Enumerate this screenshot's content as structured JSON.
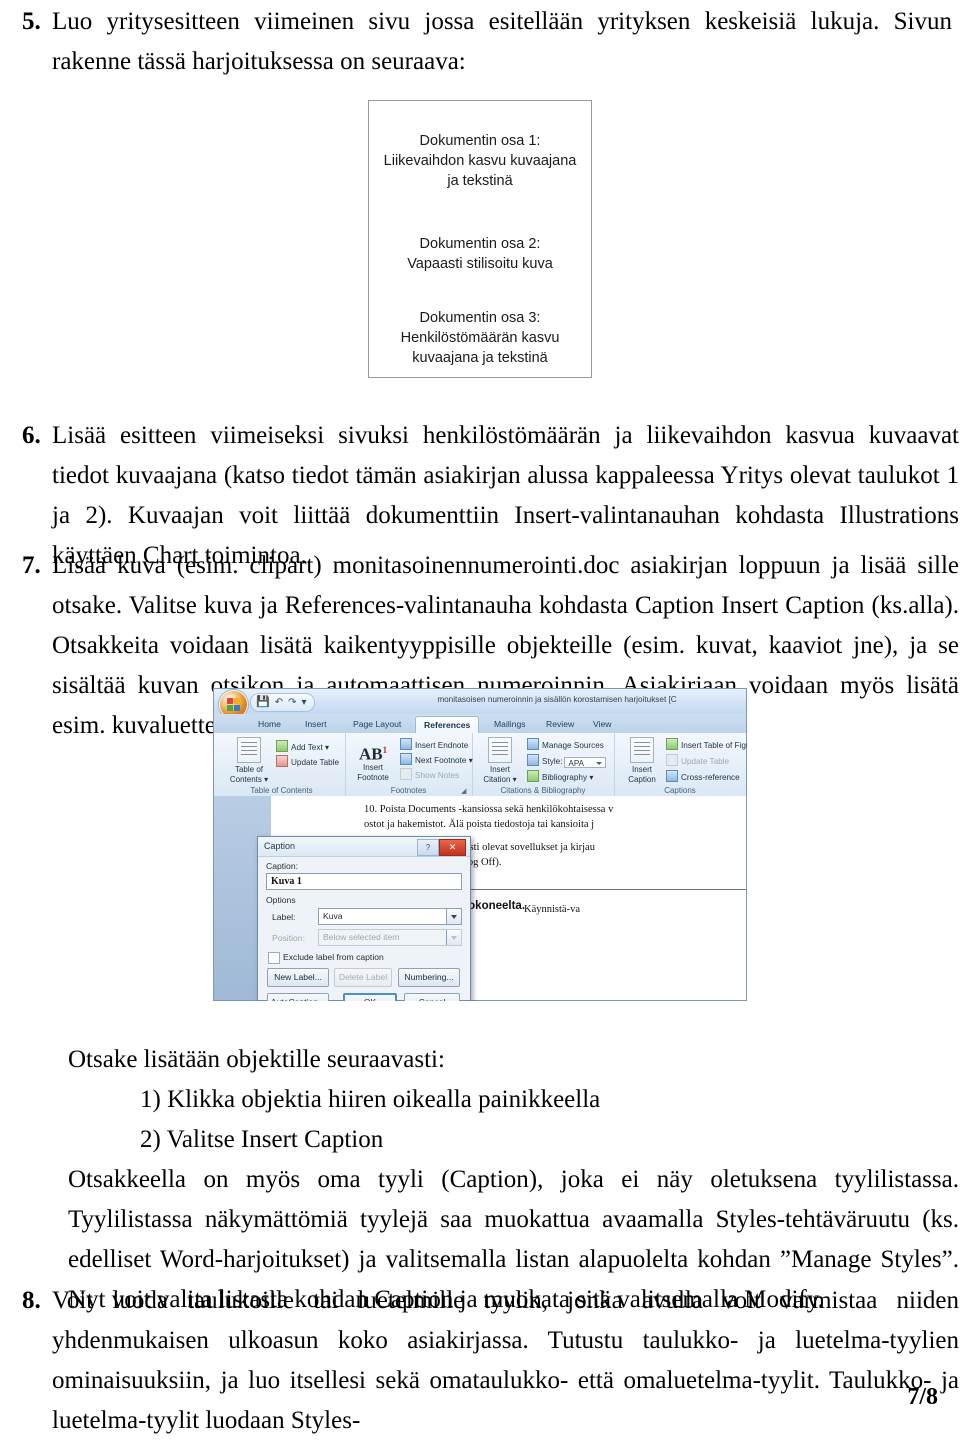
{
  "document": {
    "items": [
      {
        "number": "5.",
        "text": "Luo yritysesitteen viimeinen sivu jossa esitellään yrityksen keskeisiä lukuja. Sivun rakenne tässä harjoituksessa on seuraava:"
      },
      {
        "number": "6.",
        "text": "Lisää esitteen viimeiseksi sivuksi henkilöstömäärän ja liikevaihdon kasvua kuvaavat tiedot kuvaajana (katso tiedot tämän asiakirjan alussa kappaleessa Yritys olevat taulukot 1 ja 2). Kuvaajan voit liittää dokumenttiin Insert-valintanauhan kohdasta Illustrations käyttäen Chart toimintoa."
      },
      {
        "number": "7.",
        "text": "Lisää kuva (esim. clipart) monitasoinennumerointi.doc asiakirjan loppuun ja lisää sille otsake. Valitse kuva ja References-valintanauha kohdasta Caption Insert Caption (ks.alla). Otsakkeita voidaan lisätä kaikentyyppisille objekteille (esim. kuvat, kaaviot jne), ja se sisältää kuvan otsikon ja automaattisen numeroinnin. Asiakirjaan voidaan myös lisätä esim. kuvaluettelo sisällysluettelon tapaan otsaketietojen perusteella."
      },
      {
        "number": "8.",
        "text": "Voit luoda taulukoille tai luetelmille tyylin, jonka avulla voit varmistaa niiden yhdenmukaisen ulkoasun koko asiakirjassa. Tutustu taulukko- ja luetelma-tyylien ominaisuuksiin, ja luo itsellesi sekä omataulukko- että omaluetelma-tyylit. Taulukko- ja luetelma-tyylit luodaan Styles-"
      }
    ],
    "paragraphs": {
      "intro_caption_steps": "Otsake lisätään objektille seuraavasti:",
      "step1": "1) Klikka objektia hiiren oikealla painikkeella",
      "step2": "2) Valitse Insert Caption",
      "caption_style": "Otsakkeella on myös oma tyyli (Caption), joka ei näy oletuksena tyylilistassa. Tyylilistassa näkymättömiä tyylejä saa muokattua avaamalla Styles-tehtäväruutu (ks. edelliset Word-harjoitukset) ja valitsemalla listan alapuolelta kohdan ”Manage Styles”. Nyt voit valita listasta kohdan Caption ja muokata sitä valitsemalla Modify."
    },
    "page_number": "7/8"
  },
  "diagram": {
    "sections": [
      {
        "title": "Dokumentin osa 1:",
        "line2": "Liikevaihdon kasvu kuvaajana",
        "line3": "ja tekstinä"
      },
      {
        "title": "Dokumentin osa 2:",
        "line2": "Vapaasti stilisoitu kuva",
        "line3": ""
      },
      {
        "title": "Dokumentin osa 3:",
        "line2": "Henkilöstömäärän kasvu",
        "line3": "kuvaajana ja tekstinä"
      }
    ],
    "border_color": "#9a9a9a"
  },
  "screenshot": {
    "titlebar": {
      "doc_title": "monitasoisen numeroinnin ja sisällön korostamisen harjoitukset [C",
      "office_orb": "office-orb",
      "qat": [
        "save-icon",
        "undo-icon",
        "redo-icon",
        "customize-icon"
      ]
    },
    "tabs": [
      {
        "label": "Home",
        "active": false
      },
      {
        "label": "Insert",
        "active": false
      },
      {
        "label": "Page Layout",
        "active": false
      },
      {
        "label": "References",
        "active": true
      },
      {
        "label": "Mailings",
        "active": false
      },
      {
        "label": "Review",
        "active": false
      },
      {
        "label": "View",
        "active": false
      }
    ],
    "ribbon_groups": [
      {
        "label": "Table of Contents",
        "big_button": "Table of\nContents ▾",
        "small_buttons": [
          "Add Text ▾",
          "Update Table"
        ]
      },
      {
        "label": "Footnotes",
        "big_button": "Insert\nFootnote",
        "small_buttons": [
          "Insert Endnote",
          "Next Footnote ▾",
          "Show Notes"
        ]
      },
      {
        "label": "Citations & Bibliography",
        "big_button": "Insert\nCitation ▾",
        "small_buttons": [
          "Manage Sources",
          "Style:",
          "Bibliography ▾"
        ],
        "style_value": "APA"
      },
      {
        "label": "Captions",
        "big_button": "Insert\nCaption",
        "small_buttons": [
          "Insert Table of Figures",
          "Update Table",
          "Cross-reference"
        ]
      }
    ],
    "group_labels": {
      "toc": "Table of Contents",
      "footnotes": "Footnotes",
      "citations": "Citations & Bibliography",
      "captions": "Captions"
    },
    "buttons": {
      "toc_big_l1": "Table of",
      "toc_big_l2": "Contents ▾",
      "add_text": "Add Text ▾",
      "update_table": "Update Table",
      "insert_footnote_l1": "Insert",
      "insert_footnote_l2": "Footnote",
      "insert_endnote": "Insert Endnote",
      "next_footnote": "Next Footnote ▾",
      "show_notes": "Show Notes",
      "insert_citation_l1": "Insert",
      "insert_citation_l2": "Citation ▾",
      "manage_sources": "Manage Sources",
      "style_label": "Style:",
      "style_value": "APA",
      "bibliography": "Bibliography ▾",
      "insert_caption_l1": "Insert",
      "insert_caption_l2": "Caption",
      "insert_tof": "Insert Table of Figures",
      "update_table2": "Update Table",
      "cross_reference": "Cross-reference"
    },
    "document_text": {
      "line1": "10. Poista Documents -kansiossa sekä henkilökohtaisessa v",
      "line2": "ostot ja hakemistot. Älä poista tiedostoja tai kansioita j",
      "line3": "e työpöydällä mahdollisesti olevat sovellukset ja kirjau",
      "line4": "t-valikosta Shut Down/Log Off).",
      "line5_bold": "jaudu aina ulos tietokoneelta.",
      "line5_rest": " Käynnistä-va"
    },
    "dialog": {
      "title": "Caption",
      "help_glyph": "?",
      "close_glyph": "✕",
      "caption_label": "Caption:",
      "caption_value": "Kuva 1",
      "options_label": "Options",
      "label_label": "Label:",
      "label_value": "Kuva",
      "position_label": "Position:",
      "position_value": "Below selected item",
      "exclude_label": "Exclude label from caption",
      "exclude_checked": false,
      "buttons": {
        "new_label": "New Label...",
        "delete_label": "Delete Label",
        "numbering": "Numbering...",
        "autocaption": "AutoCaption...",
        "ok": "OK",
        "cancel": "Cancel"
      }
    }
  }
}
